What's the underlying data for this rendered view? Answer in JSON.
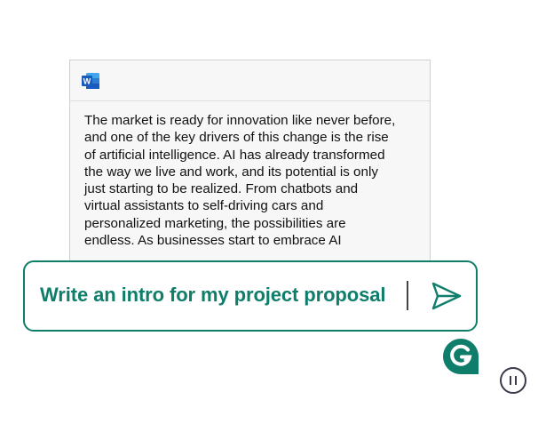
{
  "document": {
    "app_icon": "microsoft-word-icon",
    "icon_letter": "W",
    "lines": [
      "The market is ready for innovation like never before,",
      "and one of the key drivers of this change is the rise",
      "of artificial intelligence. AI has already transformed",
      "the way we live and work, and its potential is only",
      "just starting to be realized. From chatbots and",
      "virtual assistants to self-driving cars and",
      "personalized marketing, the possibilities are",
      "endless. As businesses start to embrace AI"
    ]
  },
  "prompt": {
    "text": "Write an intro for my project proposal",
    "send_icon": "send-icon"
  },
  "brand": {
    "logo": "grammarly-logo",
    "letter": "G"
  },
  "controls": {
    "pause_icon": "pause-icon"
  },
  "colors": {
    "accent": "#0e7e6a",
    "word_blue": "#185abd",
    "text": "#111111",
    "doc_background": "#f7f7f7"
  }
}
